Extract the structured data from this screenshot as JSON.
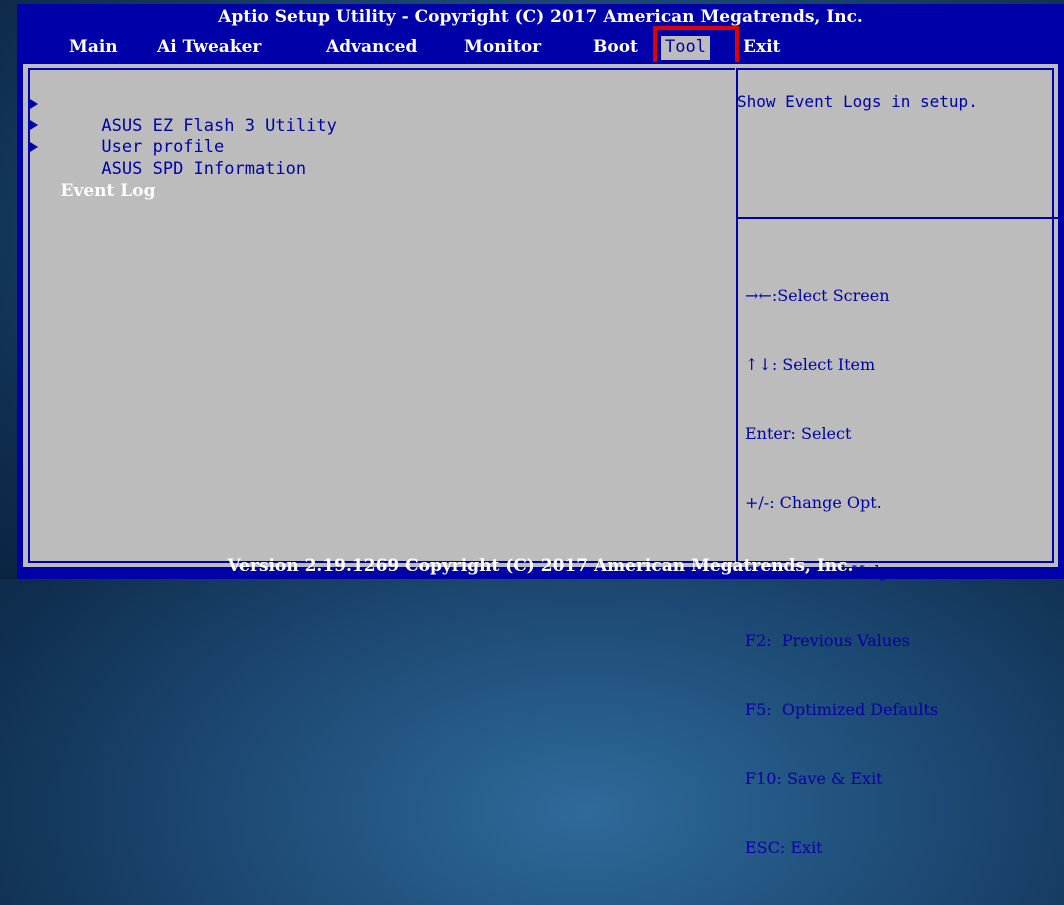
{
  "header": {
    "title": "Aptio Setup Utility - Copyright (C) 2017 American Megatrends, Inc."
  },
  "menubar": {
    "tabs": [
      {
        "label": "Main"
      },
      {
        "label": "Ai Tweaker"
      },
      {
        "label": "Advanced"
      },
      {
        "label": "Monitor"
      },
      {
        "label": "Boot"
      },
      {
        "label": "Tool",
        "active": true
      },
      {
        "label": "Exit"
      }
    ]
  },
  "main": {
    "items": [
      {
        "label": "ASUS EZ Flash 3 Utility",
        "submenu": true
      },
      {
        "label": "User profile",
        "submenu": true
      },
      {
        "label": "ASUS SPD Information",
        "submenu": true
      },
      {
        "label": "Event Log",
        "selected": true
      }
    ]
  },
  "help": {
    "description": "Show Event Logs in setup.",
    "keys": [
      "→←:Select Screen",
      "↑↓: Select Item",
      "Enter: Select",
      "+/-: Change Opt.",
      "F1:  General Help",
      "F2:  Previous Values",
      "F5:  Optimized Defaults",
      "F10: Save & Exit",
      "ESC: Exit"
    ]
  },
  "footer": {
    "version": "Version 2.19.1269 Copyright (C) 2017 American Megatrends, Inc."
  },
  "colors": {
    "bios_blue": "#0000a8",
    "panel_gray": "#bcbcbc",
    "highlight_red": "#e00000",
    "text_white": "#ffffff"
  }
}
